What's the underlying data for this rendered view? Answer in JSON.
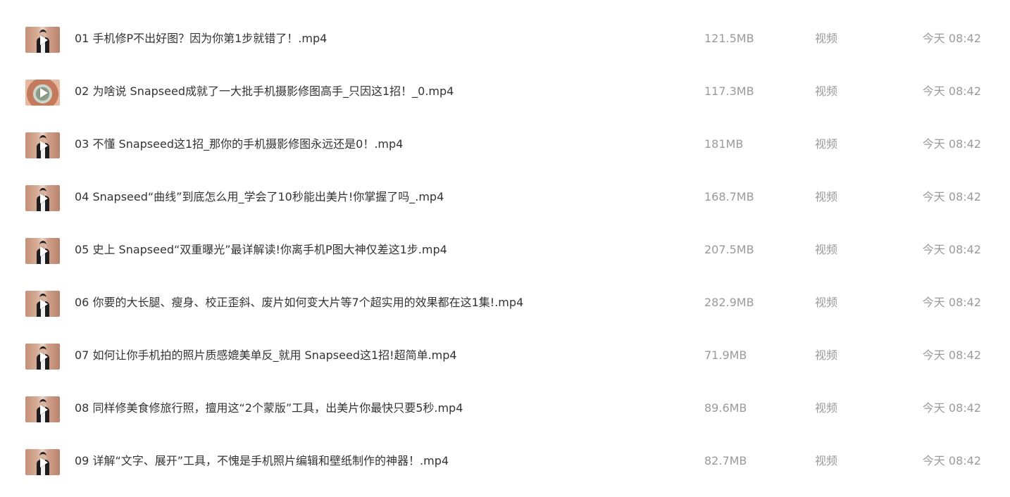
{
  "files": [
    {
      "name": "01 手机修P不出好图？因为你第1步就错了！.mp4",
      "size": "121.5MB",
      "type": "视频",
      "time": "今天 08:42",
      "thumb": "video-thumbnail"
    },
    {
      "name": "02 为啥说 Snapseed成就了一大批手机摄影修图高手_只因这1招！_0.mp4",
      "size": "117.3MB",
      "type": "视频",
      "time": "今天 08:42",
      "thumb": "video-thumbnail"
    },
    {
      "name": "03 不懂 Snapseed这1招_那你的手机摄影修图永远还是0！.mp4",
      "size": "181MB",
      "type": "视频",
      "time": "今天 08:42",
      "thumb": "video-thumbnail"
    },
    {
      "name": "04 Snapseed“曲线”到底怎么用_学会了10秒能出美片!你掌握了吗_.mp4",
      "size": "168.7MB",
      "type": "视频",
      "time": "今天 08:42",
      "thumb": "video-thumbnail"
    },
    {
      "name": "05 史上 Snapseed“双重曝光”最详解读!你离手机P图大神仅差这1步.mp4",
      "size": "207.5MB",
      "type": "视频",
      "time": "今天 08:42",
      "thumb": "video-thumbnail"
    },
    {
      "name": "06 你要的大长腿、瘦身、校正歪斜、废片如何变大片等7个超实用的效果都在这1集!.mp4",
      "size": "282.9MB",
      "type": "视频",
      "time": "今天 08:42",
      "thumb": "video-thumbnail"
    },
    {
      "name": "07 如何让你手机拍的照片质感媲美单反_就用 Snapseed这1招!超简单.mp4",
      "size": "71.9MB",
      "type": "视频",
      "time": "今天 08:42",
      "thumb": "video-thumbnail"
    },
    {
      "name": "08 同样修美食修旅行照，擅用这“2个蒙版”工具，出美片你最快只要5秒.mp4",
      "size": "89.6MB",
      "type": "视频",
      "time": "今天 08:42",
      "thumb": "video-thumbnail"
    },
    {
      "name": "09 详解“文字、展开”工具，不愧是手机照片编辑和壁纸制作的神器！.mp4",
      "size": "82.7MB",
      "type": "视频",
      "time": "今天 08:42",
      "thumb": "video-thumbnail"
    }
  ],
  "colors": {
    "name_text": "#333333",
    "meta_text": "#9a9a9a",
    "background": "#ffffff"
  },
  "icons": {
    "play": "play-icon"
  }
}
